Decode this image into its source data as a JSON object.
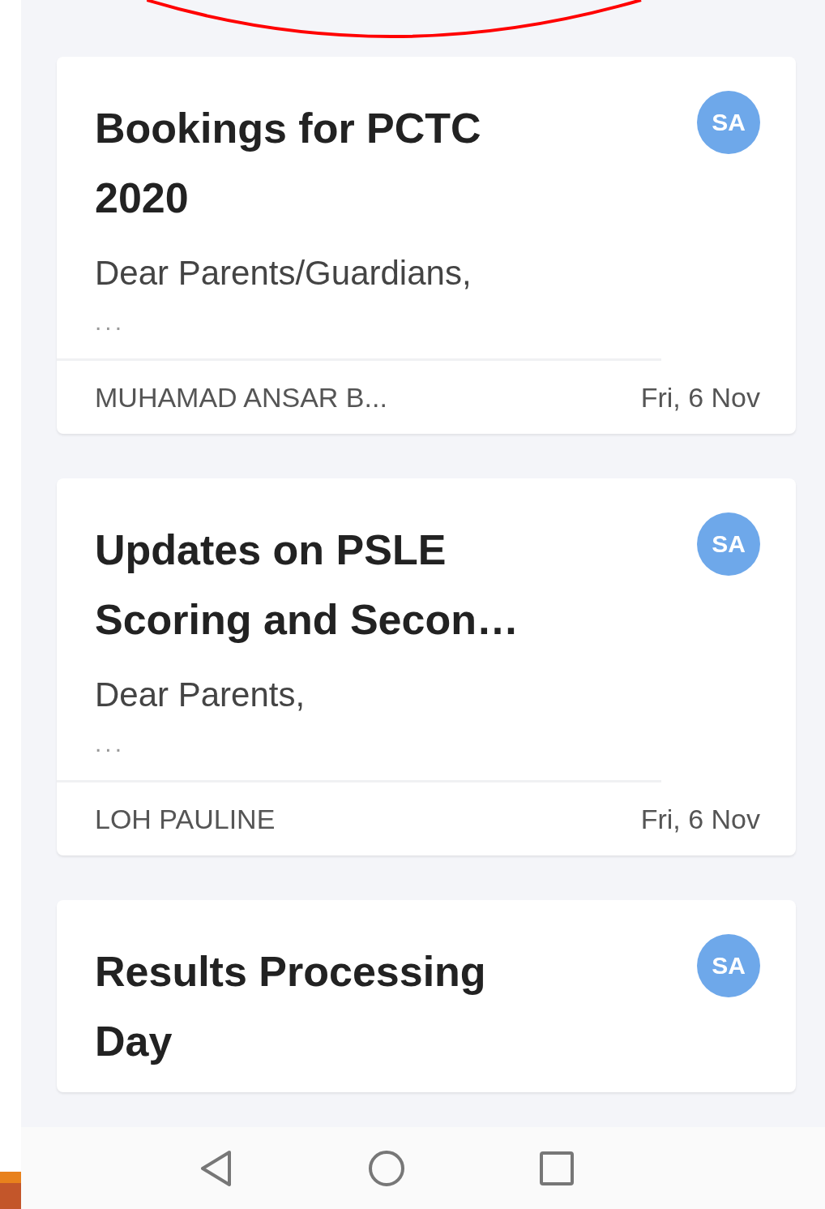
{
  "cards": [
    {
      "title": "Bookings for PCTC 2020",
      "preview": "Dear Parents/Guardians,",
      "more": "...",
      "author": "MUHAMAD ANSAR B...",
      "date": "Fri, 6 Nov",
      "avatar": "SA"
    },
    {
      "title": "Updates on PSLE Scoring and Secon…",
      "preview": "Dear Parents,",
      "more": "...",
      "author": "LOH PAULINE",
      "date": "Fri, 6 Nov",
      "avatar": "SA"
    },
    {
      "title": "Results Processing Day",
      "avatar": "SA"
    }
  ]
}
